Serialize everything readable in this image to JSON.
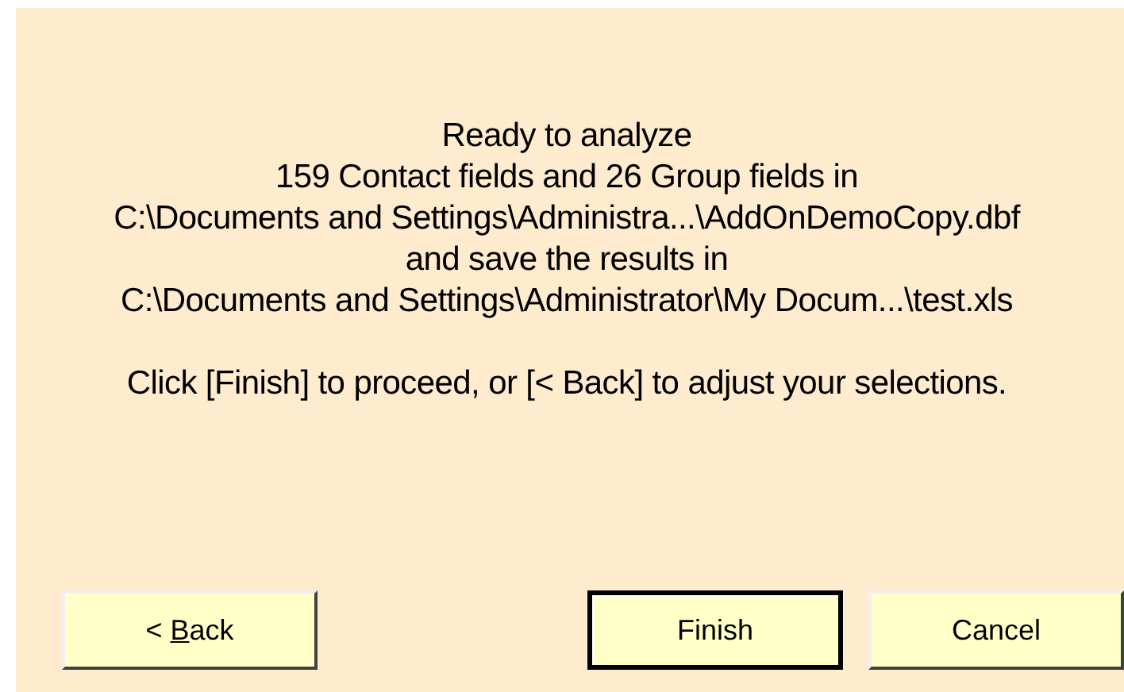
{
  "summary_lines": [
    "Ready to analyze",
    "159 Contact fields and 26 Group fields in",
    "C:\\Documents and Settings\\Administra...\\AddOnDemoCopy.dbf",
    "and save the results in",
    "C:\\Documents and Settings\\Administrator\\My Docum...\\test.xls"
  ],
  "instruction": "Click [Finish] to proceed, or [< Back] to adjust your selections.",
  "buttons": [
    {
      "label_parts": [
        {
          "text": "< ",
          "underlined": false
        },
        {
          "text": "B",
          "underlined": true
        },
        {
          "text": "ack",
          "underlined": false
        }
      ],
      "default": false
    },
    {
      "label_parts": [
        {
          "text": "Finish",
          "underlined": false
        }
      ],
      "default": true
    },
    {
      "label_parts": [
        {
          "text": "Cancel",
          "underlined": false
        }
      ],
      "default": false
    }
  ]
}
